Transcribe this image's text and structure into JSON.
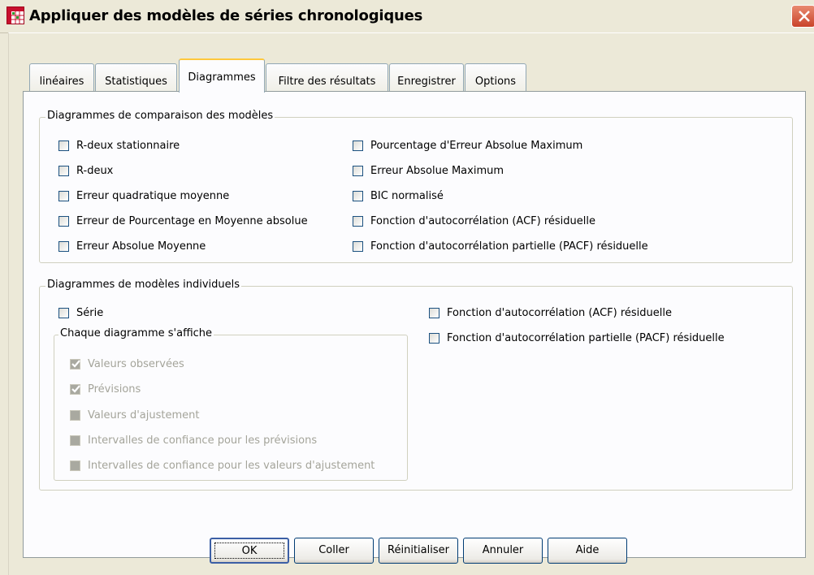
{
  "window": {
    "title": "Appliquer des modèles de séries chronologiques"
  },
  "tabs": [
    {
      "label": "linéaires",
      "active": false
    },
    {
      "label": "Statistiques",
      "active": false
    },
    {
      "label": "Diagrammes",
      "active": true
    },
    {
      "label": "Filtre des résultats",
      "active": false
    },
    {
      "label": "Enregistrer",
      "active": false
    },
    {
      "label": "Options",
      "active": false
    }
  ],
  "comparison": {
    "title": "Diagrammes de comparaison des modèles",
    "left": [
      {
        "label": "R-deux stationnaire",
        "checked": false
      },
      {
        "label": "R-deux",
        "checked": false
      },
      {
        "label": "Erreur quadratique moyenne",
        "checked": false
      },
      {
        "label": "Erreur de Pourcentage en Moyenne absolue",
        "checked": false
      },
      {
        "label": "Erreur Absolue Moyenne",
        "checked": false
      }
    ],
    "right": [
      {
        "label": "Pourcentage d'Erreur Absolue Maximum",
        "checked": false
      },
      {
        "label": "Erreur Absolue Maximum",
        "checked": false
      },
      {
        "label": "BIC normalisé",
        "checked": false
      },
      {
        "label": "Fonction d'autocorrélation (ACF) résiduelle",
        "checked": false
      },
      {
        "label": "Fonction d'autocorrélation partielle (PACF) résiduelle",
        "checked": false
      }
    ]
  },
  "individual": {
    "title": "Diagrammes de modèles individuels",
    "serie": {
      "label": "Série",
      "checked": false
    },
    "each_plot": {
      "title": "Chaque diagramme s'affiche",
      "items": [
        {
          "label": "Valeurs observées",
          "checked": true,
          "disabled": true
        },
        {
          "label": "Prévisions",
          "checked": true,
          "disabled": true
        },
        {
          "label": "Valeurs d'ajustement",
          "checked": false,
          "disabled": true
        },
        {
          "label": "Intervalles de confiance pour les prévisions",
          "checked": false,
          "disabled": true
        },
        {
          "label": "Intervalles de confiance pour les valeurs d'ajustement",
          "checked": false,
          "disabled": true
        }
      ]
    },
    "right": [
      {
        "label": "Fonction d'autocorrélation (ACF) résiduelle",
        "checked": false
      },
      {
        "label": "Fonction d'autocorrélation partielle (PACF) résiduelle",
        "checked": false
      }
    ]
  },
  "buttons": {
    "ok": "OK",
    "paste": "Coller",
    "reset": "Réinitialiser",
    "cancel": "Annuler",
    "help": "Aide"
  }
}
